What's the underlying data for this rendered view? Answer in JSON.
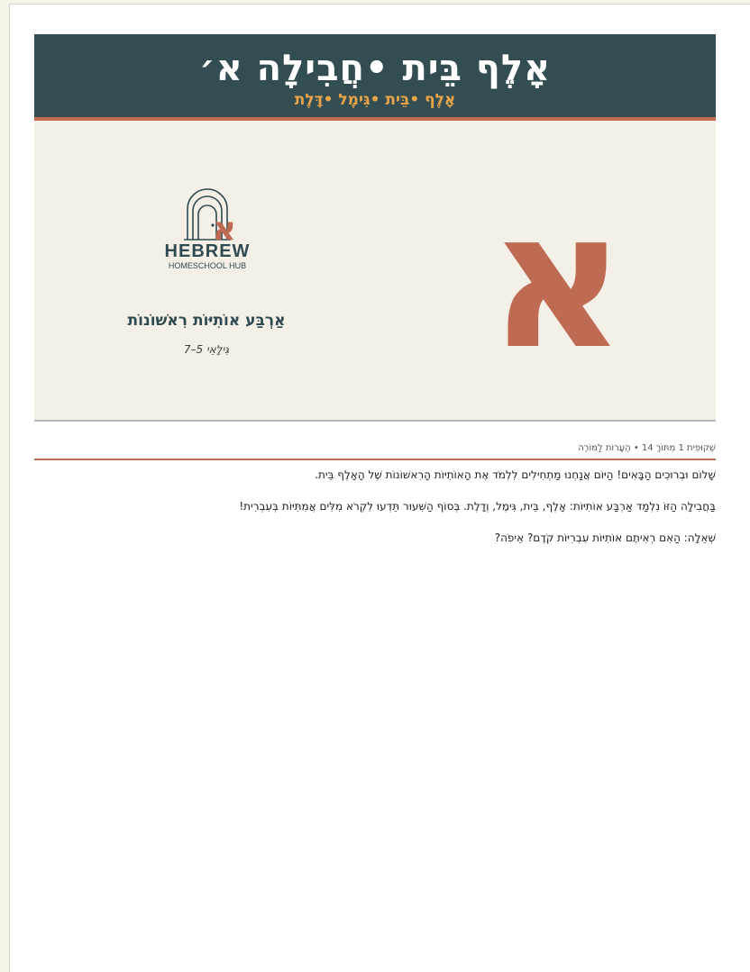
{
  "slide": {
    "title": "אָלֶף בֵּית  •חֲבִילָה א׳",
    "subtitle": "אָלֶף  •בֵּית  •גִּימֶל  •דָּלֶת",
    "logo_word": "HEBREW",
    "logo_sub": "HOMESCHOOL HUB",
    "heading": "אַרְבַּע אוֹתִיּוֹת רִאשׁוֹנוֹת",
    "age": "גִּילָאֵי 5–7",
    "big_letter": "א"
  },
  "notes": {
    "meta": "שְׁקוּפִית 1 מִתּוֹךְ 14 • הֶעָרוֹת לַמּוֹרֶה",
    "paragraphs": [
      "שָׁלוֹם וּבְרוּכִים הַבָּאִים! הַיּוֹם אֲנַחְנוּ מַתְחִילִים לִלְמֹד אֶת הָאוֹתִיּוֹת הָרִאשׁוֹנוֹת שֶׁל הָאָלֶף בֵּית.",
      "בַּחֲבִילָה הַזּוֹ נִלְמַד אַרְבַּע אוֹתִיּוֹת: אָלֶף, בֵּית, גִּימֶל, וְדָלֶת. בְּסוֹף הַשִּׁעוּר תֵּדְעוּ לִקְרֹא מִלִּים אֲמִתִּיּוֹת בְּעִבְרִית!",
      "שְׁאֵלָה: הַאִם רְאִיתֶם אוֹתִיּוֹת עִבְרִיּוֹת קֹדֶם? אֵיפֹה?"
    ]
  },
  "colors": {
    "banner": "#334e53",
    "accent": "#bf6a52",
    "gold": "#e9a44a",
    "slide_bg": "#f4f0e8"
  }
}
